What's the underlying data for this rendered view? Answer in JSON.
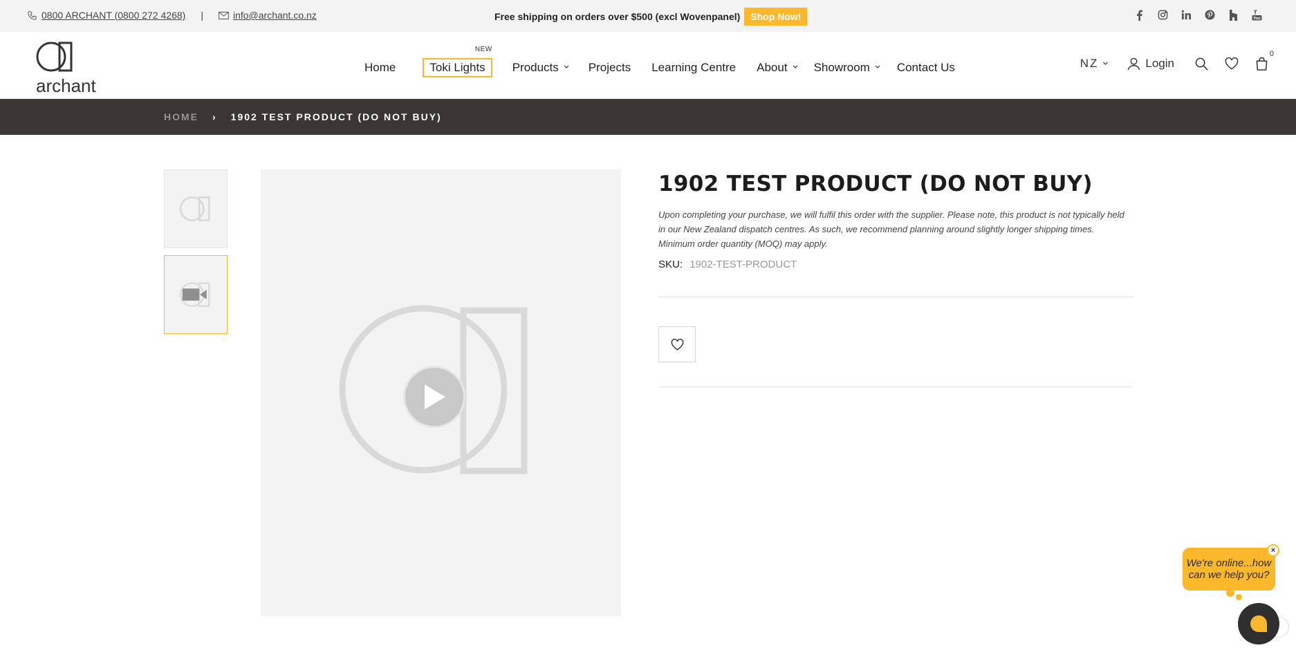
{
  "topbar": {
    "phone": "0800 ARCHANT (0800 272 4268)",
    "separator": "|",
    "email": "info@archant.co.nz",
    "promo_text": "Free shipping on orders over $500 (excl Wovenpanel)",
    "shop_now": "Shop Now!",
    "social": [
      "facebook-icon",
      "instagram-icon",
      "linkedin-icon",
      "pinterest-icon",
      "houzz-icon",
      "youtube-icon"
    ]
  },
  "header": {
    "logo_text": "archant",
    "nav": {
      "home": "Home",
      "toki_lights": "Toki Lights",
      "toki_badge": "NEW",
      "products": "Products",
      "projects": "Projects",
      "learning_centre": "Learning Centre",
      "about": "About",
      "showroom": "Showroom",
      "contact": "Contact Us"
    },
    "region": "NZ",
    "login": "Login",
    "cart_count": "0"
  },
  "breadcrumb": {
    "home": "HOME",
    "arrow": "›",
    "current": "1902 TEST PRODUCT (DO NOT BUY)"
  },
  "product": {
    "title": "1902 TEST PRODUCT (DO NOT BUY)",
    "description": "Upon completing your purchase, we will fulfil this order with the supplier. Please note, this product is not typically held in our New Zealand dispatch centres. As such, we recommend planning around slightly longer shipping times. Minimum order quantity (MOQ) may apply.",
    "sku_label": "SKU:",
    "sku_value": "1902-TEST-PRODUCT"
  },
  "chat": {
    "message": "We're online...how can we help you?",
    "close": "×"
  },
  "colors": {
    "accent": "#fbb82b",
    "breadcrumb_bg": "#3a3633",
    "topbar_bg": "#f3f3f3"
  }
}
